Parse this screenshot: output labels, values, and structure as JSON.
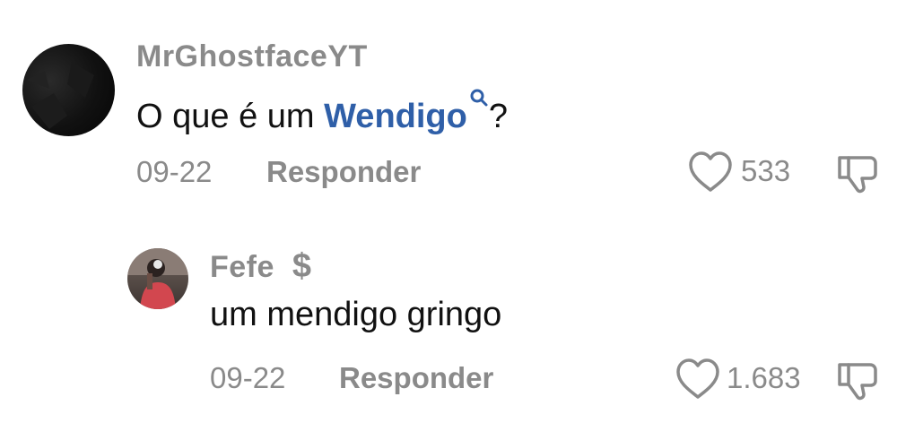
{
  "comments": [
    {
      "username": "MrGhostfaceYT",
      "text_before": "O que é um ",
      "keyword": "Wendigo",
      "text_after": "?",
      "date": "09-22",
      "reply_label": "Responder",
      "likes": "533"
    },
    {
      "username": "Fefe",
      "badge": "$",
      "text": "um mendigo gringo",
      "date": "09-22",
      "reply_label": "Responder",
      "likes": "1.683"
    }
  ],
  "colors": {
    "keyword": "#2f5fa8",
    "muted": "#8a8a8a",
    "text": "#111111"
  },
  "icons": {
    "like": "heart-outline-icon",
    "dislike": "thumbs-down-icon",
    "search": "search-icon",
    "badge": "dollar-icon"
  }
}
